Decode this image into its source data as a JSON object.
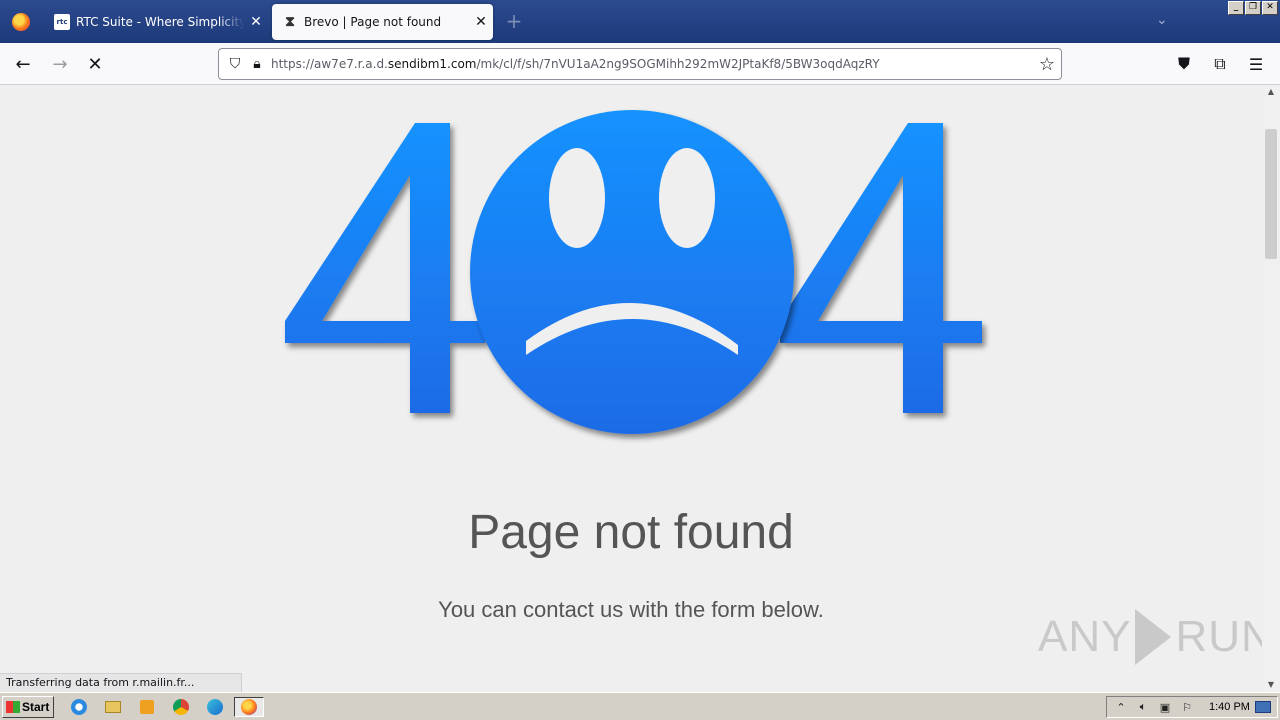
{
  "browser": {
    "tabs": [
      {
        "title": "RTC Suite - Where Simplicity Builds",
        "icon": "rtc-icon",
        "active": false
      },
      {
        "title": "Brevo | Page not found",
        "icon": "hourglass-icon",
        "active": true
      }
    ],
    "new_tab": "+",
    "url_prefix": "https://aw7e7.r.a.d.",
    "url_domain": "sendibm1.com",
    "url_suffix": "/mk/cl/f/sh/7nVU1aA2ng9SOGMihh292mW2JPtaKf8/5BW3oqdAqzRY",
    "status_text": "Transferring data from r.mailin.fr..."
  },
  "page": {
    "graphic": {
      "left_digit": "4",
      "right_digit": "4",
      "face": "sad-face",
      "color": "#1a7cf0"
    },
    "headline": "Page not found",
    "subline": "You can contact us with the form below."
  },
  "watermark": {
    "left": "ANY",
    "right": "RUN"
  },
  "taskbar": {
    "start_label": "Start",
    "clock": "1:40 PM",
    "apps": [
      "ie-icon",
      "explorer-icon",
      "media-player-icon",
      "chrome-icon",
      "edge-icon",
      "firefox-icon"
    ]
  }
}
